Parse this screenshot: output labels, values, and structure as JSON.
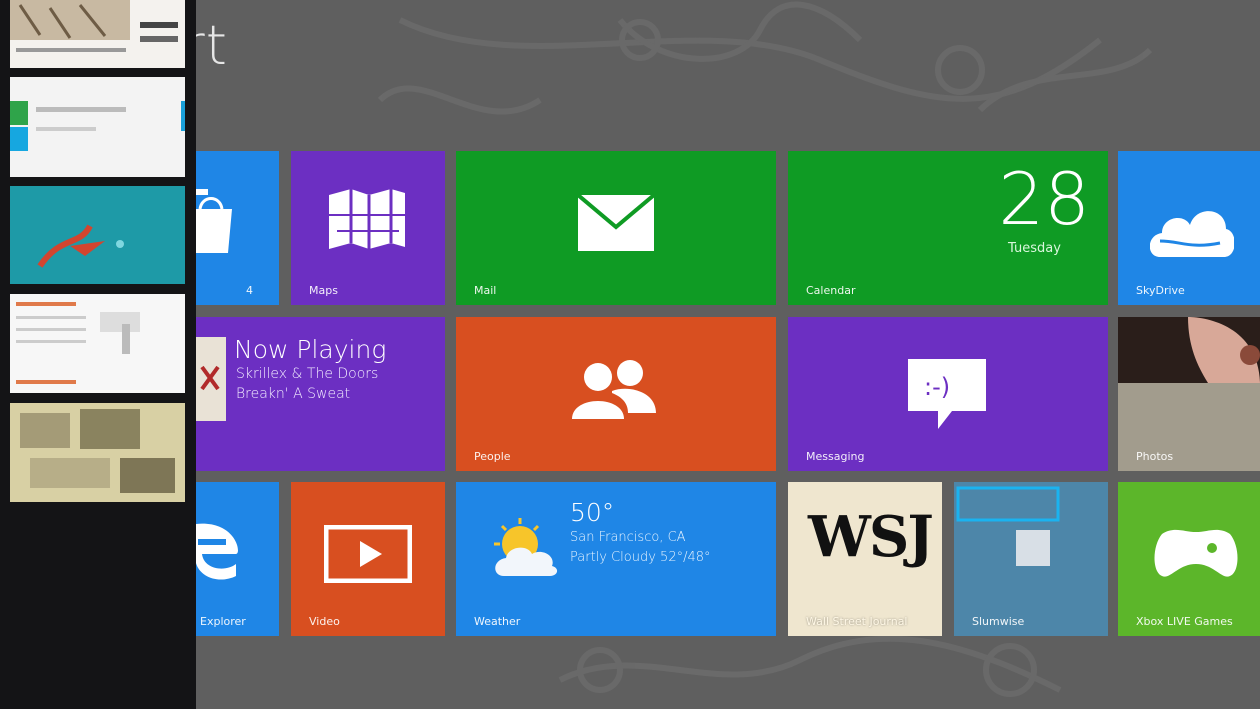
{
  "start": {
    "title": "Start"
  },
  "switcher": {
    "thumbnails": [
      "app-thumbnail-1",
      "app-thumbnail-2",
      "app-thumbnail-3",
      "app-thumbnail-4",
      "app-thumbnail-5"
    ]
  },
  "tiles": {
    "store": {
      "label": "4"
    },
    "maps": {
      "label": "Maps"
    },
    "mail": {
      "label": "Mail"
    },
    "calendar": {
      "label": "Calendar",
      "date": "28",
      "weekday": "Tuesday"
    },
    "skydrive": {
      "label": "SkyDrive"
    },
    "music": {
      "heading": "Now Playing",
      "line1": "Skrillex & The Doors",
      "line2": "Breakn' A Sweat"
    },
    "people": {
      "label": "People"
    },
    "messaging": {
      "label": "Messaging"
    },
    "photos": {
      "label": "Photos"
    },
    "ie": {
      "label": "Explorer"
    },
    "video": {
      "label": "Video"
    },
    "weather": {
      "label": "Weather",
      "temp": "50°",
      "location": "San Francisco, CA",
      "conditions": "Partly Cloudy 52°/48°"
    },
    "wsj": {
      "label": "Wall Street Journal",
      "logo": "WSJ"
    },
    "slumwise": {
      "label": "Slumwise"
    },
    "xbox": {
      "label": "Xbox LIVE Games"
    }
  },
  "colors": {
    "background": "#5f5f5f",
    "blue": "#1f86e6",
    "purple": "#6c2fc2",
    "green": "#0f9b24",
    "orange": "#d84f20",
    "lime": "#5cb62a"
  },
  "icons": {
    "store": "shopping-bag-icon",
    "maps": "map-icon",
    "mail": "envelope-icon",
    "skydrive": "cloud-icon",
    "people": "people-icon",
    "messaging": "speech-bubble-icon",
    "ie": "internet-explorer-icon",
    "video": "play-icon",
    "weather": "sun-cloud-icon",
    "xbox": "gamepad-icon"
  }
}
